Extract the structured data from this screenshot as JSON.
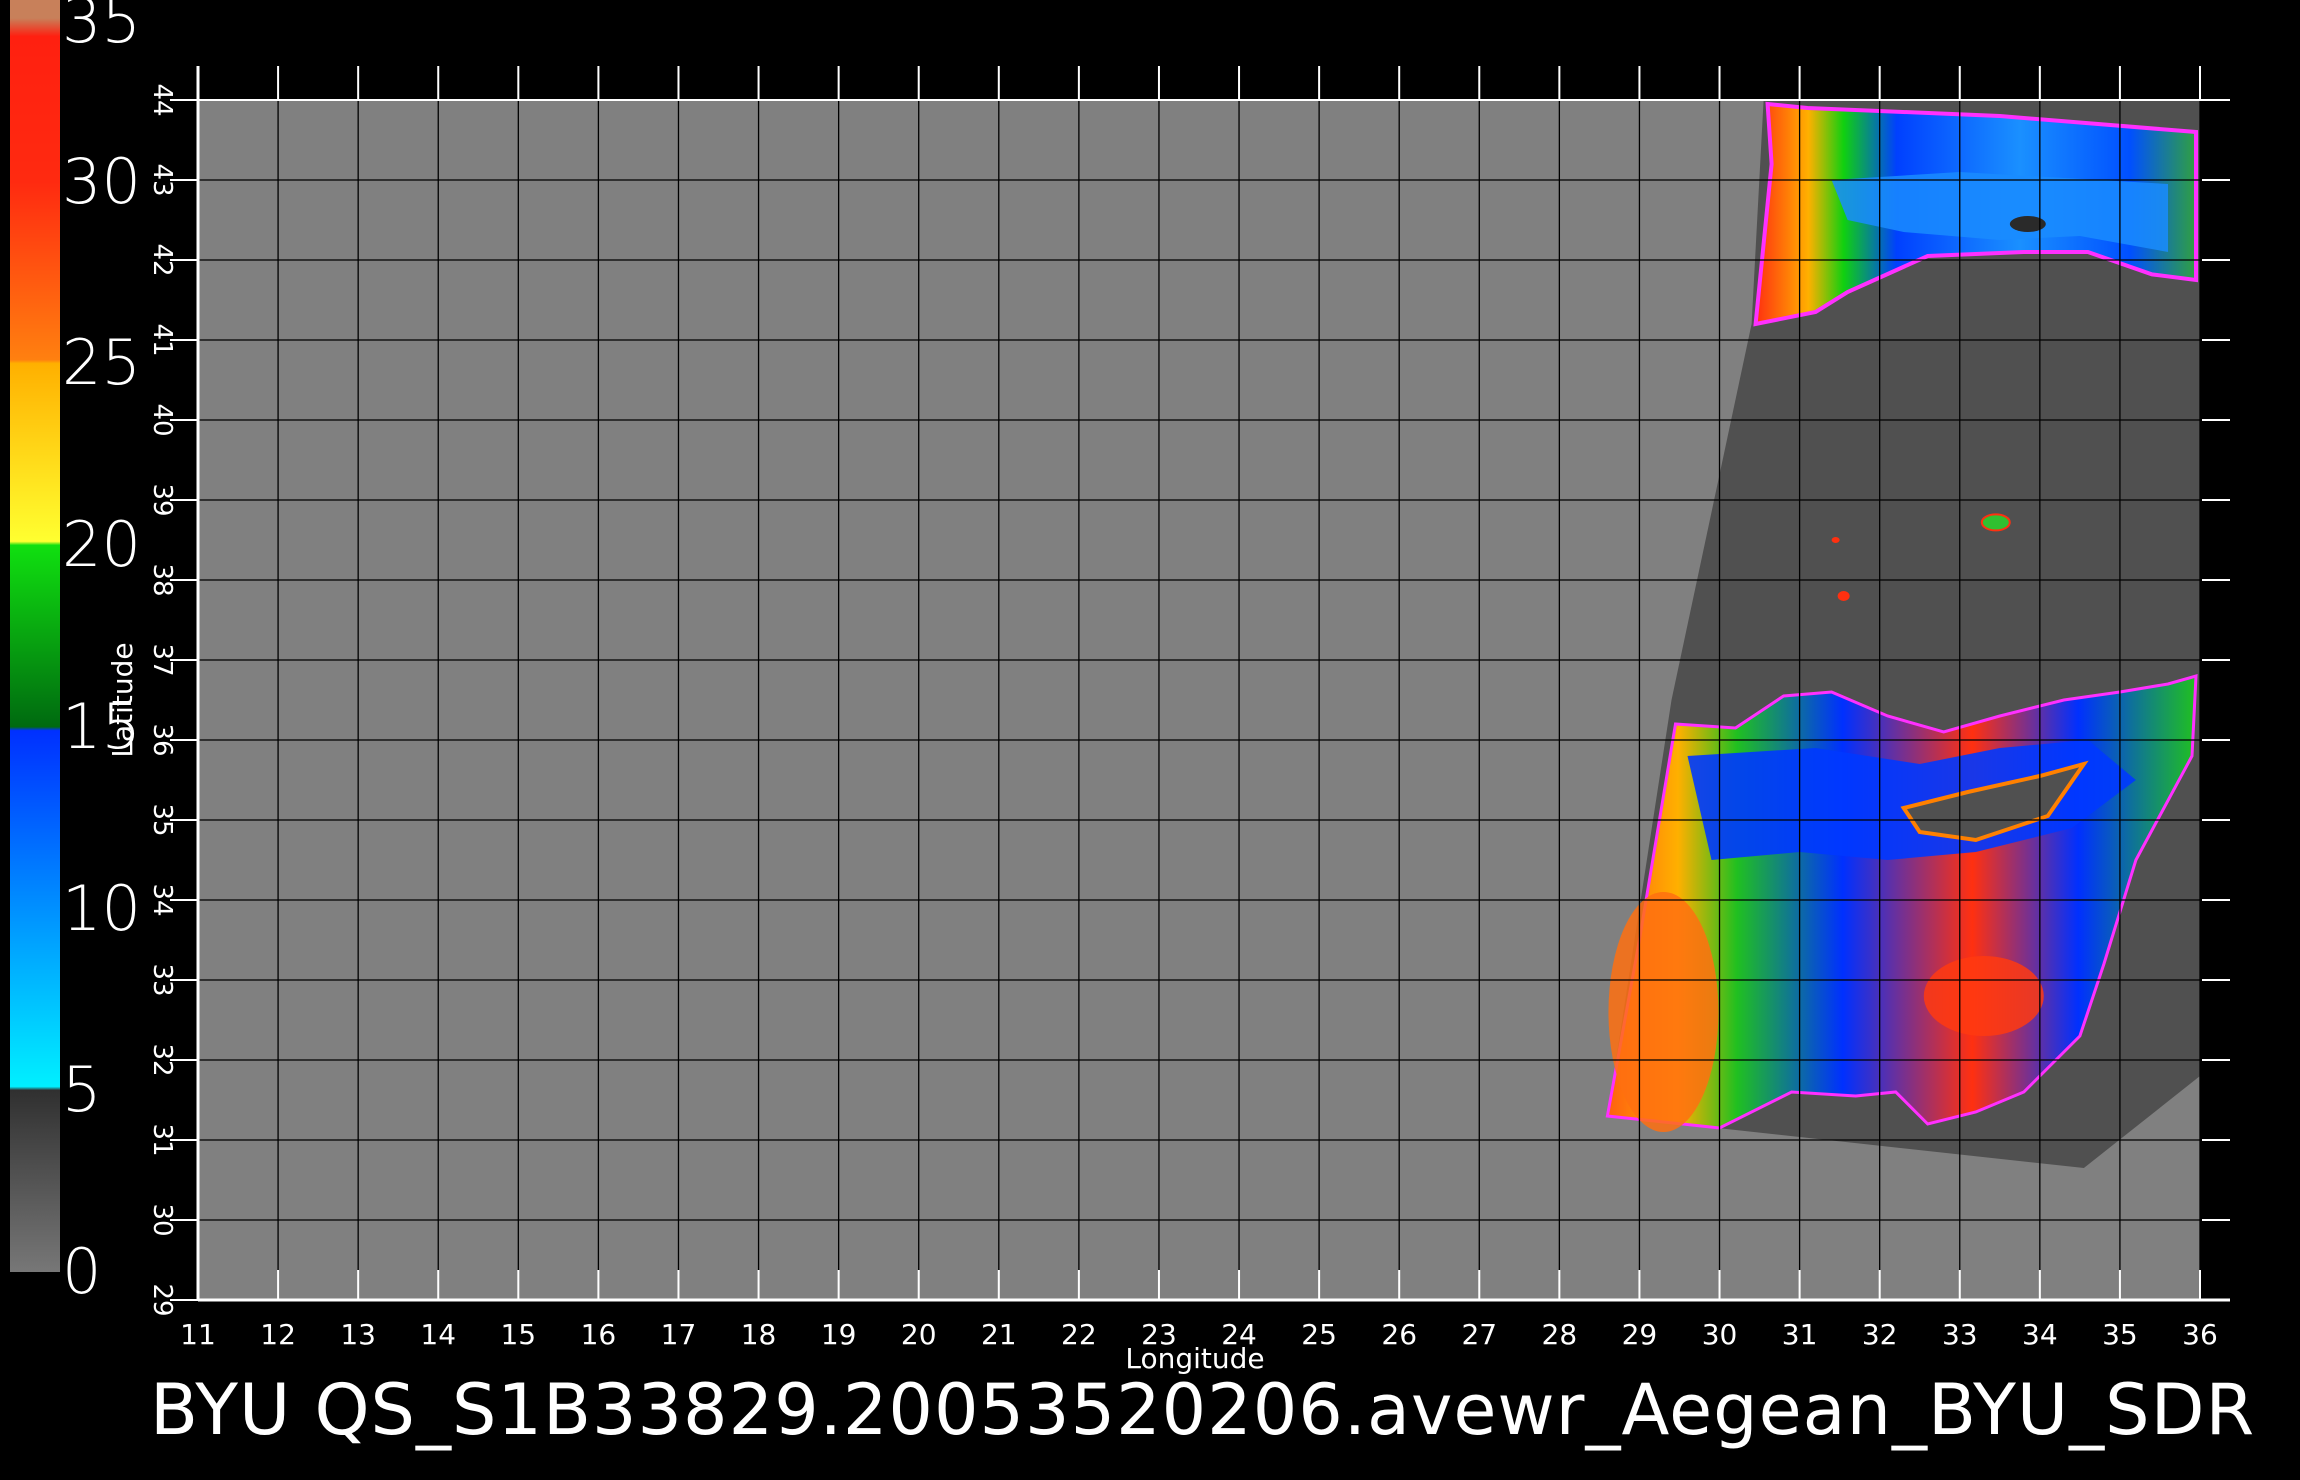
{
  "chart_data": {
    "type": "heatmap",
    "xlabel": "Longitude",
    "ylabel": "Latitude",
    "xlim": [
      11,
      36
    ],
    "ylim": [
      29,
      44
    ],
    "x_ticks": [
      "11",
      "12",
      "13",
      "14",
      "15",
      "16",
      "17",
      "18",
      "19",
      "20",
      "21",
      "22",
      "23",
      "24",
      "25",
      "26",
      "27",
      "28",
      "29",
      "30",
      "31",
      "32",
      "33",
      "34",
      "35",
      "36"
    ],
    "y_ticks": [
      "29",
      "30",
      "31",
      "32",
      "33",
      "34",
      "35",
      "36",
      "37",
      "38",
      "39",
      "40",
      "41",
      "42",
      "43",
      "44"
    ],
    "grid": true,
    "colorbar": {
      "range": [
        0,
        35
      ],
      "tick_labels": [
        "0",
        "5",
        "10",
        "15",
        "20",
        "25",
        "30",
        "35"
      ],
      "stops": [
        {
          "value": 0,
          "color": "#777777"
        },
        {
          "value": 5,
          "color": "#303030"
        },
        {
          "value": 5.1,
          "color": "#00f0ff"
        },
        {
          "value": 10,
          "color": "#0090ff"
        },
        {
          "value": 14.9,
          "color": "#0030ff"
        },
        {
          "value": 15,
          "color": "#006a10"
        },
        {
          "value": 20,
          "color": "#10e010"
        },
        {
          "value": 20.1,
          "color": "#ffff30"
        },
        {
          "value": 25,
          "color": "#ffb000"
        },
        {
          "value": 25.1,
          "color": "#ff8010"
        },
        {
          "value": 30,
          "color": "#ff2a10"
        },
        {
          "value": 34,
          "color": "#ff2010"
        },
        {
          "value": 34.5,
          "color": "#c8805a"
        },
        {
          "value": 35,
          "color": "#c8805a"
        }
      ]
    },
    "regions": [
      {
        "name": "swath-north",
        "lon": [
          30.4,
          36.0
        ],
        "lat": [
          41.2,
          43.9
        ],
        "dominant_values": [
          10,
          13,
          18,
          28
        ]
      },
      {
        "name": "swath-south",
        "lon": [
          28.6,
          36.0
        ],
        "lat": [
          31.2,
          36.8
        ],
        "dominant_values": [
          12,
          18,
          24,
          30
        ]
      }
    ],
    "colors": {
      "plot_bg": "#808080",
      "swath_land": "#505050",
      "background": "#000000"
    }
  },
  "footer": {
    "text": "BYU  QS_S1B33829.20053520206.avewr_Aegean_BYU_SDR"
  }
}
